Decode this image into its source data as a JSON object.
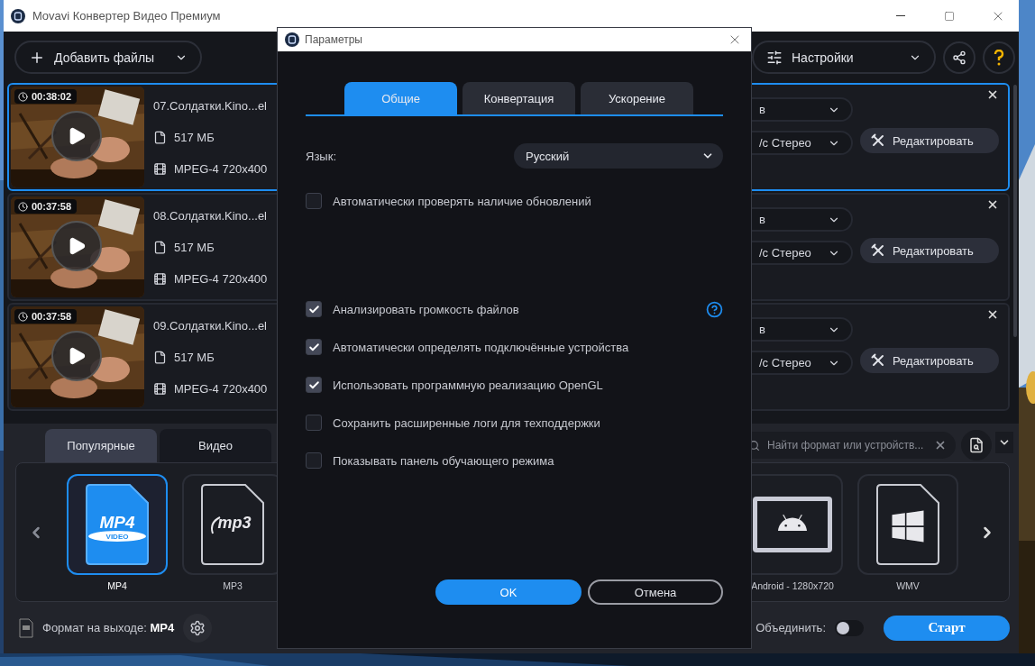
{
  "window": {
    "title": "Movavi Конвертер Видео Премиум"
  },
  "toolbar": {
    "add_files": "Добавить файлы",
    "settings": "Настройки"
  },
  "files": [
    {
      "duration": "00:38:02",
      "name": "07.Солдатки.Kino...el",
      "size": "517 МБ",
      "codec": "MPEG-4 720x400",
      "video_field": "в",
      "audio_field": "/с Стерео",
      "edit": "Редактировать",
      "selected": true
    },
    {
      "duration": "00:37:58",
      "name": "08.Солдатки.Kino...el",
      "size": "517 МБ",
      "codec": "MPEG-4 720x400",
      "video_field": "в",
      "audio_field": "/с Стерео",
      "edit": "Редактировать",
      "selected": false
    },
    {
      "duration": "00:37:58",
      "name": "09.Солдатки.Kino...el",
      "size": "517 МБ",
      "codec": "MPEG-4 720x400",
      "video_field": "в",
      "audio_field": "/с Стерео",
      "edit": "Редактировать",
      "selected": false
    }
  ],
  "format_tabs": [
    {
      "label": "Популярные",
      "selected": true
    },
    {
      "label": "Видео",
      "selected": false
    }
  ],
  "search": {
    "placeholder": "Найти формат или устройств..."
  },
  "formats_left": [
    {
      "kind": "mp4",
      "label": "MP4",
      "icon_text": "MP4",
      "icon_subtext": "VIDEO",
      "selected": true
    },
    {
      "kind": "mp3",
      "label": "MP3",
      "icon_text": "mp3",
      "selected": false
    }
  ],
  "formats_right": [
    {
      "kind": "android",
      "label": "Android - 1280x720",
      "selected": false
    },
    {
      "kind": "windows",
      "label": "WMV",
      "selected": false
    }
  ],
  "output": {
    "text": "Формат на выходе: **MP4**"
  },
  "merge": {
    "label": "Объединить:",
    "on": false
  },
  "start": "Старт",
  "dialog": {
    "title": "Параметры",
    "tabs": [
      {
        "label": "Общие",
        "selected": true
      },
      {
        "label": "Конвертация",
        "selected": false
      },
      {
        "label": "Ускорение",
        "selected": false
      }
    ],
    "language": {
      "label": "Язык:",
      "value": "Русский"
    },
    "option_groups": [
      [
        {
          "label": "Автоматически проверять наличие обновлений",
          "checked": false,
          "help": false
        }
      ],
      [
        {
          "label": "Анализировать громкость файлов",
          "checked": true,
          "help": true
        },
        {
          "label": "Автоматически определять подключённые устройства",
          "checked": true,
          "help": false
        },
        {
          "label": "Использовать программную реализацию OpenGL",
          "checked": true,
          "help": false
        },
        {
          "label": "Сохранить расширенные логи для техподдержки",
          "checked": false,
          "help": false
        },
        {
          "label": "Показывать панель обучающего режима",
          "checked": false,
          "help": false
        }
      ]
    ],
    "ok": "OK",
    "cancel": "Отмена"
  }
}
